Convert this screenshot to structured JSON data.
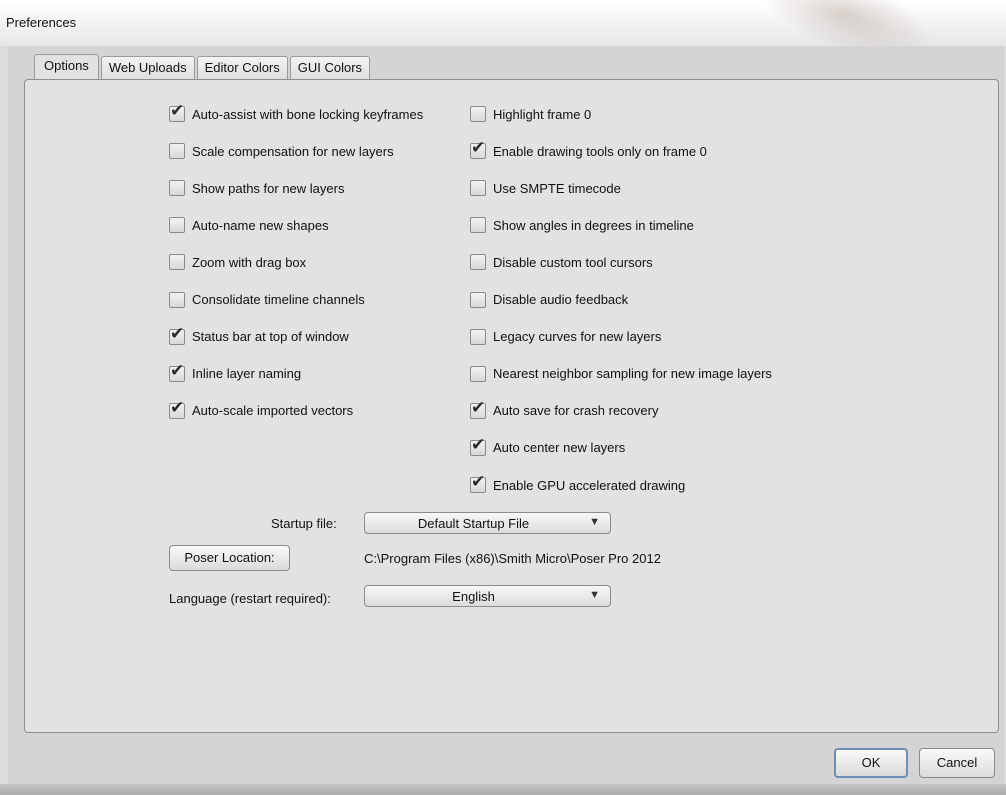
{
  "window": {
    "title": "Preferences"
  },
  "tabs": [
    {
      "label": "Options",
      "active": true
    },
    {
      "label": "Web Uploads",
      "active": false
    },
    {
      "label": "Editor Colors",
      "active": false
    },
    {
      "label": "GUI Colors",
      "active": false
    }
  ],
  "left_options": [
    {
      "label": "Auto-assist with bone locking keyframes",
      "checked": true
    },
    {
      "label": "Scale compensation for new layers",
      "checked": false
    },
    {
      "label": "Show paths for new layers",
      "checked": false
    },
    {
      "label": "Auto-name new shapes",
      "checked": false
    },
    {
      "label": "Zoom with drag box",
      "checked": false
    },
    {
      "label": "Consolidate timeline channels",
      "checked": false
    },
    {
      "label": "Status bar at top of window",
      "checked": true
    },
    {
      "label": "Inline layer naming",
      "checked": true
    },
    {
      "label": "Auto-scale imported vectors",
      "checked": true
    }
  ],
  "right_options": [
    {
      "label": "Highlight frame 0",
      "checked": false
    },
    {
      "label": "Enable drawing tools only on frame 0",
      "checked": true
    },
    {
      "label": "Use SMPTE timecode",
      "checked": false
    },
    {
      "label": "Show angles in degrees in timeline",
      "checked": false
    },
    {
      "label": "Disable custom tool cursors",
      "checked": false
    },
    {
      "label": "Disable audio feedback",
      "checked": false
    },
    {
      "label": "Legacy curves for new layers",
      "checked": false
    },
    {
      "label": "Nearest neighbor sampling for new image layers",
      "checked": false
    },
    {
      "label": "Auto save for crash recovery",
      "checked": true
    },
    {
      "label": "Auto center new layers",
      "checked": true
    },
    {
      "label": "Enable GPU accelerated drawing",
      "checked": true
    }
  ],
  "startup": {
    "label": "Startup file:",
    "value": "Default Startup File"
  },
  "poser": {
    "button_label": "Poser Location:",
    "path": "C:\\Program Files (x86)\\Smith Micro\\Poser Pro 2012"
  },
  "language": {
    "label": "Language (restart required):",
    "value": "English"
  },
  "footer": {
    "ok_label": "OK",
    "cancel_label": "Cancel"
  },
  "icons": {
    "check": "check-icon",
    "dropdown_arrow": "triangle-down-icon"
  }
}
